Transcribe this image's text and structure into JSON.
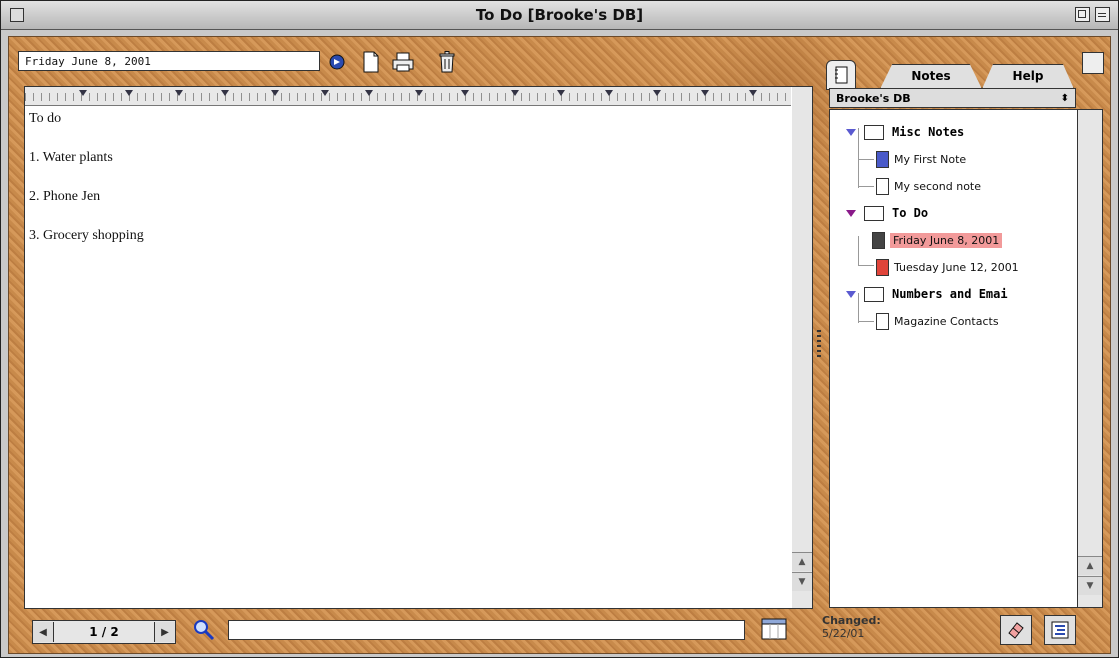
{
  "window": {
    "title": "To Do [Brooke's DB]"
  },
  "toolbar": {
    "date_value": "Friday June 8, 2001",
    "icons": [
      "go-arrow-icon",
      "new-note-icon",
      "print-icon",
      "trash-icon"
    ]
  },
  "editor": {
    "lines": [
      "To do",
      "1. Water plants",
      "2. Phone Jen",
      "3. Grocery shopping"
    ]
  },
  "sidebar": {
    "tabs": {
      "notes": "Notes",
      "help": "Help"
    },
    "database": "Brooke's DB",
    "tree": {
      "folder1": "Misc Notes",
      "folder1_notes": [
        "My First Note",
        "My second note"
      ],
      "folder2": "To Do",
      "folder2_notes": [
        "Friday June 8, 2001",
        "Tuesday June 12, 2001"
      ],
      "folder3": "Numbers and Emai",
      "folder3_notes": [
        "Magazine Contacts"
      ]
    }
  },
  "footer": {
    "page": "1 / 2",
    "search_value": "",
    "changed_label": "Changed:",
    "changed_date": "5/22/01"
  },
  "colors": {
    "selection": "#f29a9a",
    "folder_triangle": "#5a5ad0",
    "texture": "#c88a4b"
  }
}
